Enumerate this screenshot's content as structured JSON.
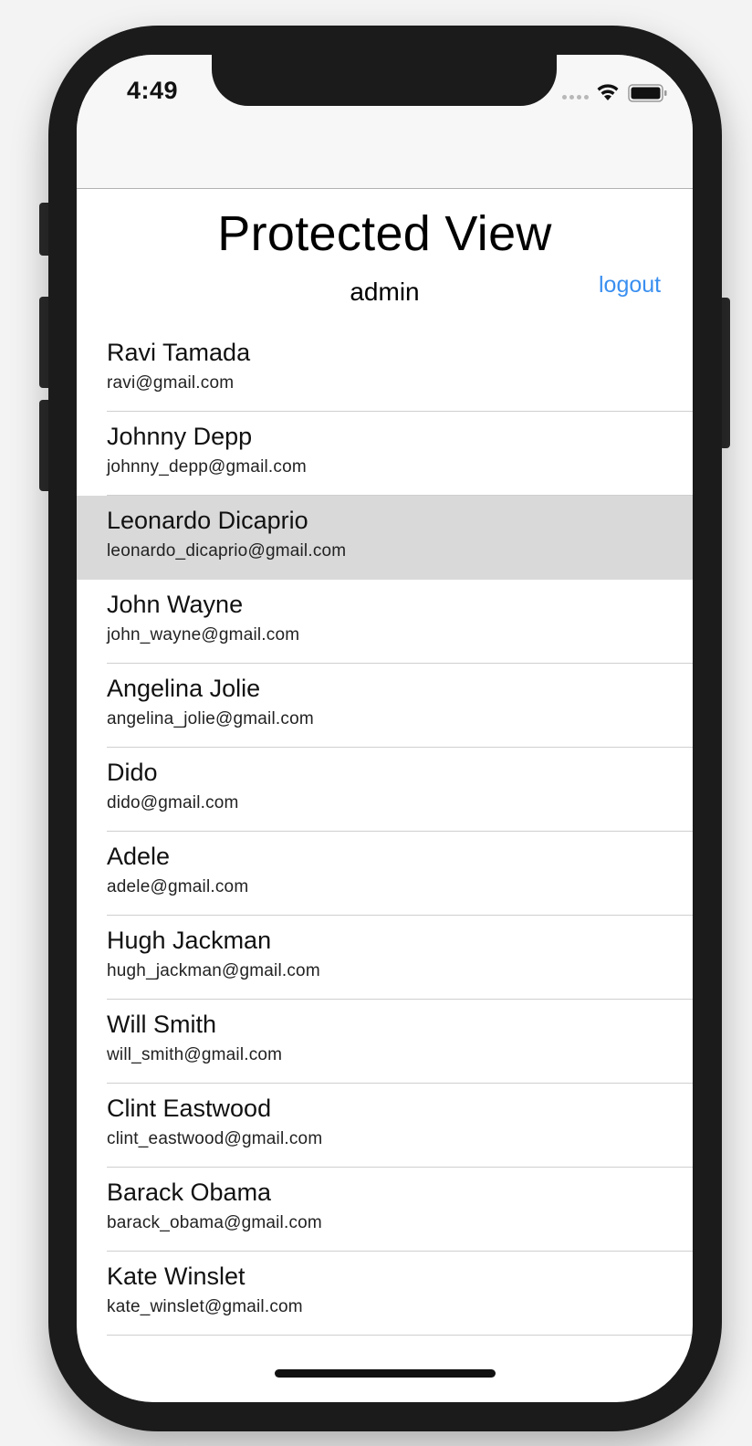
{
  "status_bar": {
    "time": "4:49"
  },
  "header": {
    "title": "Protected View",
    "username": "admin",
    "logout_label": "logout"
  },
  "contacts": [
    {
      "name": "Ravi Tamada",
      "email": "ravi@gmail.com",
      "selected": false
    },
    {
      "name": "Johnny Depp",
      "email": "johnny_depp@gmail.com",
      "selected": false
    },
    {
      "name": "Leonardo Dicaprio",
      "email": "leonardo_dicaprio@gmail.com",
      "selected": true
    },
    {
      "name": "John Wayne",
      "email": "john_wayne@gmail.com",
      "selected": false
    },
    {
      "name": "Angelina Jolie",
      "email": "angelina_jolie@gmail.com",
      "selected": false
    },
    {
      "name": "Dido",
      "email": "dido@gmail.com",
      "selected": false
    },
    {
      "name": "Adele",
      "email": "adele@gmail.com",
      "selected": false
    },
    {
      "name": "Hugh Jackman",
      "email": "hugh_jackman@gmail.com",
      "selected": false
    },
    {
      "name": "Will Smith",
      "email": "will_smith@gmail.com",
      "selected": false
    },
    {
      "name": "Clint Eastwood",
      "email": "clint_eastwood@gmail.com",
      "selected": false
    },
    {
      "name": "Barack Obama",
      "email": "barack_obama@gmail.com",
      "selected": false
    },
    {
      "name": "Kate Winslet",
      "email": "kate_winslet@gmail.com",
      "selected": false
    }
  ],
  "colors": {
    "link": "#3a8ff0",
    "selected_row": "#d9d9d9"
  }
}
